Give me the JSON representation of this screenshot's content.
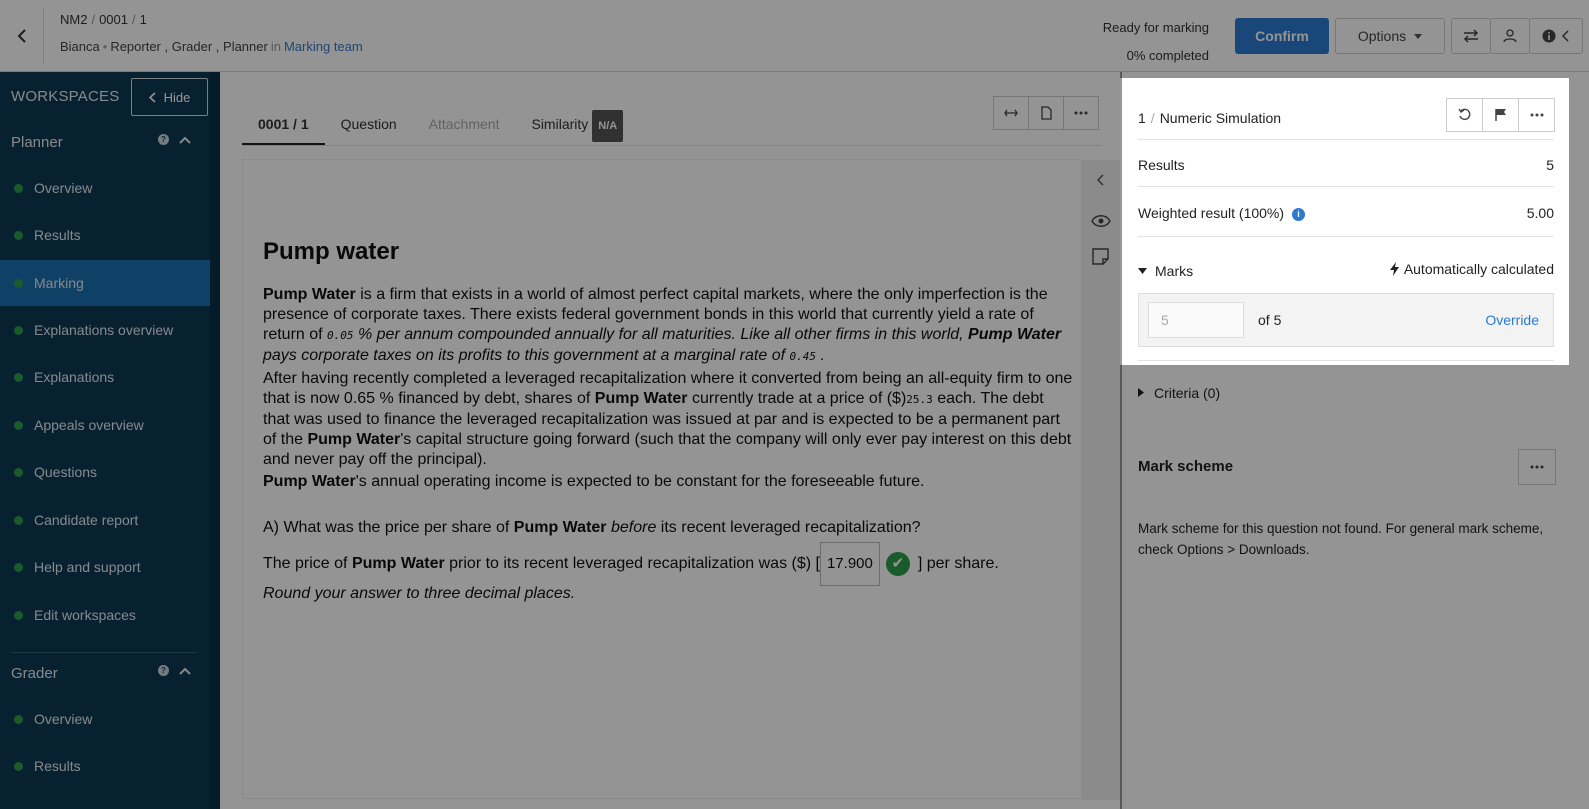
{
  "header": {
    "crumb1": "NM2",
    "crumb2": "0001",
    "crumb3": "1",
    "user_name": "Bianca",
    "roles": "Reporter , Grader , Planner",
    "in_word": "in",
    "team_link": "Marking team",
    "status_line1": "Ready for marking",
    "status_line2": "0% completed",
    "confirm_label": "Confirm",
    "options_label": "Options"
  },
  "sidebar": {
    "workspaces_label": "WORKSPACES",
    "hide_label": "Hide",
    "planner_label": "Planner",
    "planner_items": [
      {
        "label": "Overview"
      },
      {
        "label": "Results"
      },
      {
        "label": "Marking"
      },
      {
        "label": "Explanations overview"
      },
      {
        "label": "Explanations"
      },
      {
        "label": "Appeals overview"
      },
      {
        "label": "Questions"
      },
      {
        "label": "Candidate report"
      },
      {
        "label": "Help and support"
      },
      {
        "label": "Edit workspaces"
      }
    ],
    "active_item": "Marking",
    "grader_label": "Grader",
    "grader_items": [
      {
        "label": "Overview"
      },
      {
        "label": "Results"
      }
    ]
  },
  "tabs": {
    "t1": "0001 / 1",
    "t2": "Question",
    "t3": "Attachment",
    "t4": "Similarity",
    "t4_badge": "N/A"
  },
  "question": {
    "title": "Pump water",
    "company": "Pump Water",
    "p1_a": " is a firm that exists in a world of almost perfect capital markets, where the only imperfection is the presence of corporate taxes. There exists federal government bonds in this world that currently yield a rate of return of ",
    "p1_rate": "0.05",
    "p1_b": " % per annum compounded annually for all maturities. Like all other firms in this world, ",
    "p1_c": " pays corporate taxes on its profits to this government at a marginal rate of ",
    "p1_tax": "0.45",
    "p1_d": " .",
    "p2_a": "After having recently completed a leveraged recapitalization where it converted from being an all-equity firm to one that is now 0.65 % financed by debt, shares of ",
    "p2_b": " currently trade at a price of ($)",
    "p2_price": "25.3",
    "p2_c": " each. The debt that was used to finance the leveraged recapitalization was issued at par and is expected to be a permanent part of the ",
    "p2_d": "'s capital structure going forward (such that the company will only ever pay interest on this debt and never pay off the principal).",
    "p3_b": "'s annual operating income is expected to be constant for the foreseeable future.",
    "qa_a": "A) What was the price per share of ",
    "qa_before": "before",
    "qa_b": " its recent leveraged recapitalization?",
    "ans_a": "The price of ",
    "ans_b": " prior to its recent leveraged recapitalization was ($) [",
    "ans_value": "17.900",
    "ans_c": "] per share.",
    "round_note": "Round your answer to three decimal places."
  },
  "marking": {
    "question_num": "1",
    "question_type": "Numeric Simulation",
    "results_label": "Results",
    "results_value": "5",
    "weighted_label": "Weighted result (100%)",
    "weighted_value": "5.00",
    "marks_label": "Marks",
    "auto_label": "Automatically calculated",
    "marks_input_placeholder": "5",
    "of_text": "of 5",
    "override_label": "Override",
    "criteria_label": "Criteria (0)",
    "mark_scheme_title": "Mark scheme",
    "mark_scheme_text": "Mark scheme for this question not found. For general mark scheme, check Options > Downloads."
  }
}
